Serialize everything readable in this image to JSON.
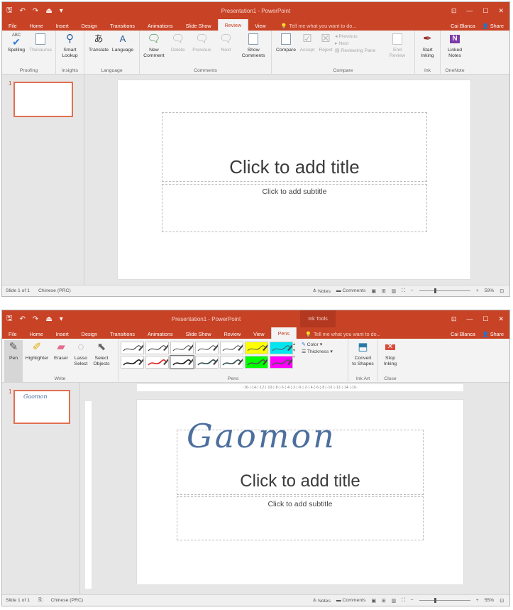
{
  "window1": {
    "qat": {
      "save": "🖫",
      "undo": "↶",
      "undo_drop": "▾",
      "redo": "↷",
      "start": "⏏",
      "customize": "▾"
    },
    "title": "Presentation1 - PowerPoint",
    "controls": {
      "ribbon_opts": "⊡",
      "min": "—",
      "max": "☐",
      "close": "✕"
    },
    "tabs": [
      "File",
      "Home",
      "Insert",
      "Design",
      "Transitions",
      "Animations",
      "Slide Show",
      "Review",
      "View"
    ],
    "tell_me": "Tell me what you want to do...",
    "user": "Cai Blanca",
    "share": "Share",
    "groups": {
      "proofing": {
        "label": "Proofing",
        "spelling": "Spelling",
        "thesaurus": "Thesaurus",
        "abc": "ABC"
      },
      "insights": {
        "label": "Insights",
        "smart_lookup_1": "Smart",
        "smart_lookup_2": "Lookup"
      },
      "language": {
        "label": "Language",
        "translate": "Translate",
        "language": "Language"
      },
      "comments": {
        "label": "Comments",
        "new_1": "New",
        "new_2": "Comment",
        "delete": "Delete",
        "previous": "Previous",
        "next": "Next",
        "show_1": "Show",
        "show_2": "Comments"
      },
      "compare": {
        "label": "Compare",
        "compare": "Compare",
        "accept": "Accept",
        "reject": "Reject",
        "previous": "Previous",
        "next": "Next",
        "reviewing_pane": "Reviewing Pane",
        "end_1": "End",
        "end_2": "Review"
      },
      "ink": {
        "label": "Ink",
        "start_1": "Start",
        "start_2": "Inking"
      },
      "onenote": {
        "label": "OneNote",
        "linked_1": "Linked",
        "linked_2": "Notes"
      }
    },
    "slide_number": "1",
    "title_placeholder": "Click to add title",
    "subtitle_placeholder": "Click to add subtitle",
    "status": {
      "slide": "Slide 1 of 1",
      "language": "Chinese (PRC)",
      "notes": "Notes",
      "comments": "Comments",
      "zoom": "59%",
      "zoom_fraction": 0.3
    }
  },
  "window2": {
    "title": "Presentation1 - PowerPoint",
    "context_tab": "Ink Tools",
    "tabs": [
      "File",
      "Home",
      "Insert",
      "Design",
      "Transitions",
      "Animations",
      "Slide Show",
      "Review",
      "View",
      "Pens"
    ],
    "tell_me": "Tell me what you want to do...",
    "user": "Cai Blanca",
    "share": "Share",
    "groups": {
      "write": {
        "label": "Write",
        "pen": "Pen",
        "highlighter": "Highlighter",
        "eraser": "Eraser",
        "lasso_1": "Lasso",
        "lasso_2": "Select",
        "select_1": "Select",
        "select_2": "Objects"
      },
      "pens": {
        "label": "Pens",
        "color": "Color",
        "thickness": "Thickness",
        "swatches": [
          {
            "color": "#2b2b2b",
            "bg": "#ffffff"
          },
          {
            "color": "#2b2b2b",
            "bg": "#ffffff"
          },
          {
            "color": "#4a4a4a",
            "bg": "#ffffff"
          },
          {
            "color": "#4a4a4a",
            "bg": "#ffffff"
          },
          {
            "color": "#4a4a4a",
            "bg": "#ffffff"
          },
          {
            "color": "#ffff00",
            "bg": "#ffff00"
          },
          {
            "color": "#00e5ee",
            "bg": "#00e5ee"
          },
          {
            "color": "#1a1a1a",
            "bg": "#ffffff"
          },
          {
            "color": "#e02020",
            "bg": "#ffffff"
          },
          {
            "color": "#1a1a1a",
            "bg": "#ffffff"
          },
          {
            "color": "#2f4f4f",
            "bg": "#ffffff"
          },
          {
            "color": "#2f4f4f",
            "bg": "#ffffff"
          },
          {
            "color": "#00ff00",
            "bg": "#00ff00"
          },
          {
            "color": "#ff00ff",
            "bg": "#ff00ff"
          }
        ]
      },
      "ink_art": {
        "label": "Ink Art",
        "convert_1": "Convert",
        "convert_2": "to Shapes"
      },
      "close": {
        "label": "Close",
        "stop_1": "Stop",
        "stop_2": "Inking"
      }
    },
    "ruler_text": "·16·¦·14·¦·12·¦·10·¦·8·¦·6·¦·4·¦·2·¦·0·¦·2·¦·4·¦·6·¦·8·¦·10·¦·12·¦·14·¦·16·",
    "slide_number": "1",
    "thumb_ink": "Gaomon",
    "ink_text": "Gaomon",
    "title_placeholder": "Click to add title",
    "subtitle_placeholder": "Click to add subtitle",
    "status": {
      "slide": "Slide 1 of 1",
      "language": "Chinese (PRC)",
      "notes": "Notes",
      "comments": "Comments",
      "zoom": "55%",
      "zoom_fraction": 0.3
    }
  }
}
